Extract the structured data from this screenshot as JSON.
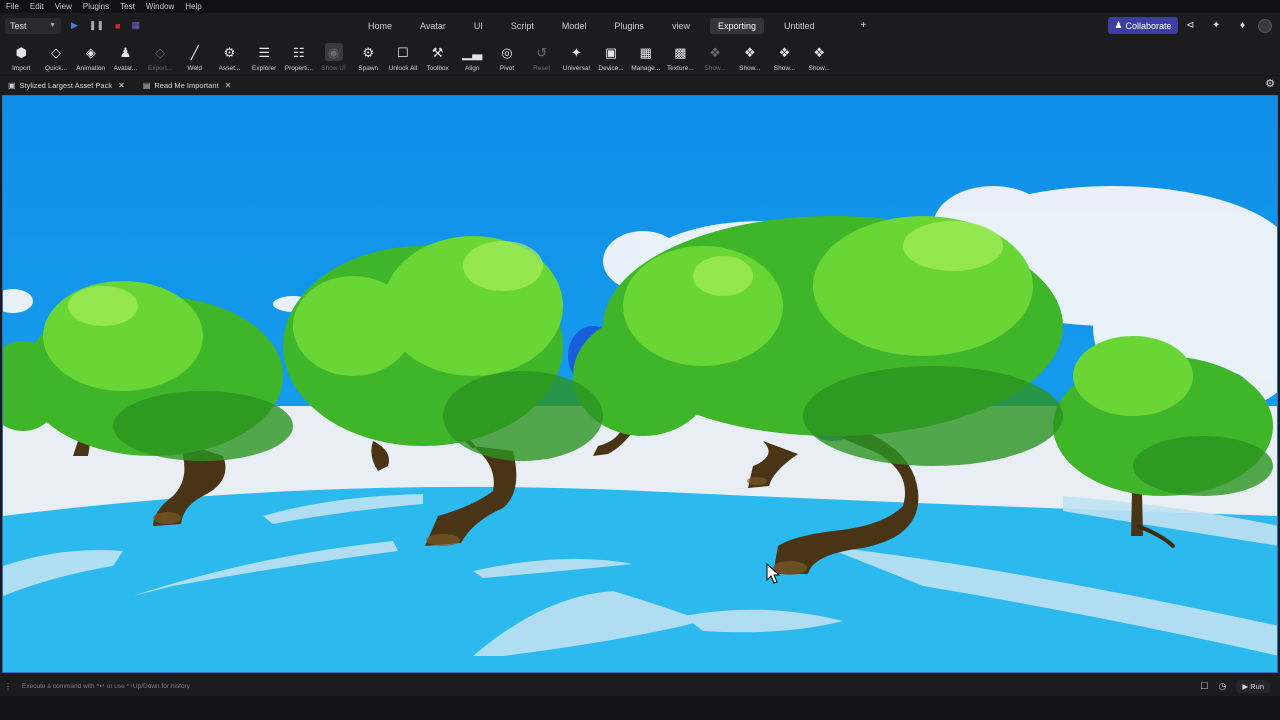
{
  "menu": [
    "File",
    "Edit",
    "View",
    "Plugins",
    "Test",
    "Window",
    "Help"
  ],
  "topbar": {
    "mode_value": "Test",
    "tabs": [
      "Home",
      "Avatar",
      "UI",
      "Script",
      "Model",
      "Plugins",
      "view",
      "Exporting",
      "Untitled",
      "+"
    ],
    "active_tab": "Exporting",
    "collaborate_label": "Collaborate"
  },
  "toolbar": [
    {
      "label": "Import",
      "icon": "cube-icon",
      "enabled": true
    },
    {
      "label": "Quick...",
      "icon": "diamond-icon",
      "enabled": true
    },
    {
      "label": "Animation",
      "icon": "animation-icon",
      "enabled": true
    },
    {
      "label": "Avatar...",
      "icon": "avatar-icon",
      "enabled": true
    },
    {
      "label": "Export...",
      "icon": "diamond-icon",
      "enabled": false
    },
    {
      "label": "Weld",
      "icon": "weld-icon",
      "enabled": true
    },
    {
      "label": "Asset...",
      "icon": "asset-icon",
      "enabled": true
    },
    {
      "label": "Explorer",
      "icon": "explorer-icon",
      "enabled": true
    },
    {
      "label": "Properti...",
      "icon": "properties-icon",
      "enabled": true
    },
    {
      "label": "Show UI",
      "icon": "eye-icon",
      "enabled": false
    },
    {
      "label": "Spawn",
      "icon": "gear-icon",
      "enabled": true
    },
    {
      "label": "Unlock All",
      "icon": "unlock-icon",
      "enabled": true
    },
    {
      "label": "Toolbox",
      "icon": "toolbox-icon",
      "enabled": true
    },
    {
      "label": "Align",
      "icon": "align-icon",
      "enabled": true
    },
    {
      "label": "Pivot",
      "icon": "pivot-icon",
      "enabled": true
    },
    {
      "label": "Reset",
      "icon": "reset-icon",
      "enabled": false
    },
    {
      "label": "Universal",
      "icon": "universal-icon",
      "enabled": true
    },
    {
      "label": "Device...",
      "icon": "device-icon",
      "enabled": true
    },
    {
      "label": "Manage...",
      "icon": "manage-icon",
      "enabled": true
    },
    {
      "label": "Texture...",
      "icon": "texture-icon",
      "enabled": true
    },
    {
      "label": "Show...",
      "icon": "show-icon",
      "enabled": false
    },
    {
      "label": "Show...",
      "icon": "show-icon",
      "enabled": true
    },
    {
      "label": "Show...",
      "icon": "show-icon",
      "enabled": true
    },
    {
      "label": "Show...",
      "icon": "show-icon",
      "enabled": true
    }
  ],
  "doc_tabs": [
    "Stylized Largest Asset Pack",
    "Read Me Important"
  ],
  "command_bar": {
    "hint": "Execute a command with ^↵ or use ^↑Up/Down for history",
    "run_label": "Run"
  }
}
